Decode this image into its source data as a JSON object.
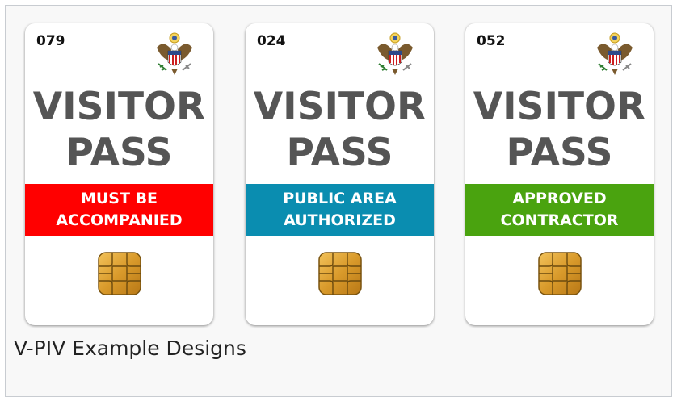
{
  "cards": [
    {
      "number": "079",
      "line1": "VISITOR",
      "line2": "PASS",
      "band_line1": "MUST BE",
      "band_line2": "ACCOMPANIED",
      "band_color": "#ff0000"
    },
    {
      "number": "024",
      "line1": "VISITOR",
      "line2": "PASS",
      "band_line1": "PUBLIC AREA",
      "band_line2": "AUTHORIZED",
      "band_color": "#0a8db0"
    },
    {
      "number": "052",
      "line1": "VISITOR",
      "line2": "PASS",
      "band_line1": "APPROVED",
      "band_line2": "CONTRACTOR",
      "band_color": "#4aa30f"
    }
  ],
  "caption": "V-PIV Example Designs",
  "icons": {
    "seal": "great-seal-icon",
    "chip": "smart-chip-icon"
  }
}
